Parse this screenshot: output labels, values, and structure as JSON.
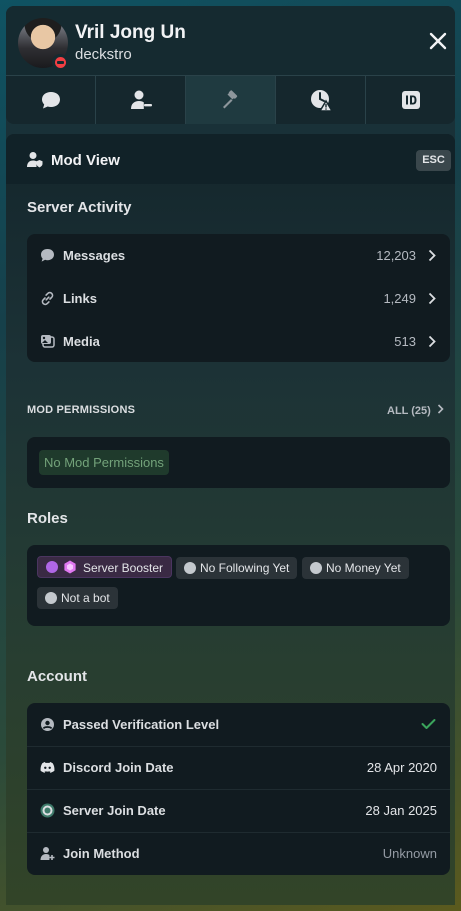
{
  "header": {
    "display_name": "Vril Jong Un",
    "username": "deckstro"
  },
  "tabs": [
    {
      "icon": "chat-icon"
    },
    {
      "icon": "user-remove-icon"
    },
    {
      "icon": "hammer-icon"
    },
    {
      "icon": "timeout-icon"
    },
    {
      "icon": "id-icon"
    }
  ],
  "mod_view": {
    "title": "Mod View",
    "esc_label": "ESC"
  },
  "server_activity": {
    "title": "Server Activity",
    "rows": [
      {
        "label": "Messages",
        "value": "12,203"
      },
      {
        "label": "Links",
        "value": "1,249"
      },
      {
        "label": "Media",
        "value": "513"
      }
    ]
  },
  "mod_permissions": {
    "title": "MOD PERMISSIONS",
    "all_label": "ALL (25)",
    "chip": "No Mod Permissions"
  },
  "roles": {
    "title": "Roles",
    "items": [
      "Server Booster",
      "No Following Yet",
      "No Money Yet",
      "Not a bot"
    ]
  },
  "account": {
    "title": "Account",
    "rows": [
      {
        "label": "Passed Verification Level",
        "value": ""
      },
      {
        "label": "Discord Join Date",
        "value": "28 Apr 2020"
      },
      {
        "label": "Server Join Date",
        "value": "28 Jan 2025"
      },
      {
        "label": "Join Method",
        "value": "Unknown"
      }
    ]
  },
  "colors": {
    "status_dnd": "#f23f43",
    "check_green": "#3ba55c",
    "booster_purple": "#b067e6"
  }
}
